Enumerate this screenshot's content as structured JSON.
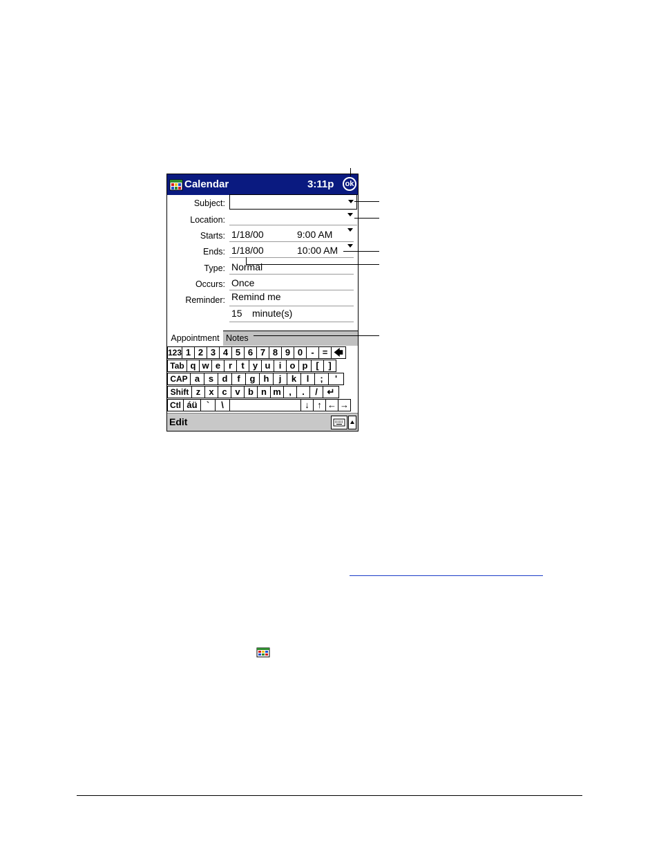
{
  "titlebar": {
    "app_title": "Calendar",
    "clock": "3:11p",
    "ok_label": "ok"
  },
  "form": {
    "subject_label": "Subject:",
    "subject_value": "",
    "location_label": "Location:",
    "location_value": "",
    "starts_label": "Starts:",
    "starts_date": "1/18/00",
    "starts_time": "9:00 AM",
    "ends_label": "Ends:",
    "ends_date": "1/18/00",
    "ends_time": "10:00 AM",
    "type_label": "Type:",
    "type_value": "Normal",
    "occurs_label": "Occurs:",
    "occurs_value": "Once",
    "reminder_label": "Reminder:",
    "reminder_value": "Remind me",
    "reminder_amount": "15",
    "reminder_unit": "minute(s)"
  },
  "tabs": {
    "appointment": "Appointment",
    "notes": "Notes"
  },
  "keyboard": {
    "rows": [
      [
        "123",
        "1",
        "2",
        "3",
        "4",
        "5",
        "6",
        "7",
        "8",
        "9",
        "0",
        "-",
        "=",
        "🡄"
      ],
      [
        "Tab",
        "q",
        "w",
        "e",
        "r",
        "t",
        "y",
        "u",
        "i",
        "o",
        "p",
        "[",
        "]"
      ],
      [
        "CAP",
        "a",
        "s",
        "d",
        "f",
        "g",
        "h",
        "j",
        "k",
        "l",
        ";",
        "'"
      ],
      [
        "Shift",
        "z",
        "x",
        "c",
        "v",
        "b",
        "n",
        "m",
        ",",
        ".",
        "/",
        "↵"
      ],
      [
        "Ctl",
        "áü",
        "`",
        "\\",
        " ",
        "↓",
        "↑",
        "←",
        "→"
      ]
    ]
  },
  "menubar": {
    "edit_label": "Edit"
  },
  "icons": {
    "logo": "calendar-icon",
    "dropdown": "dropdown-arrow-icon",
    "sip": "keyboard-icon",
    "sip_arrow": "up-arrow-icon"
  },
  "colors": {
    "titlebar": "#0a1a80",
    "menubar": "#c8c8c8",
    "notes_tab": "#c0c0c0",
    "link": "#1a3cc8"
  }
}
